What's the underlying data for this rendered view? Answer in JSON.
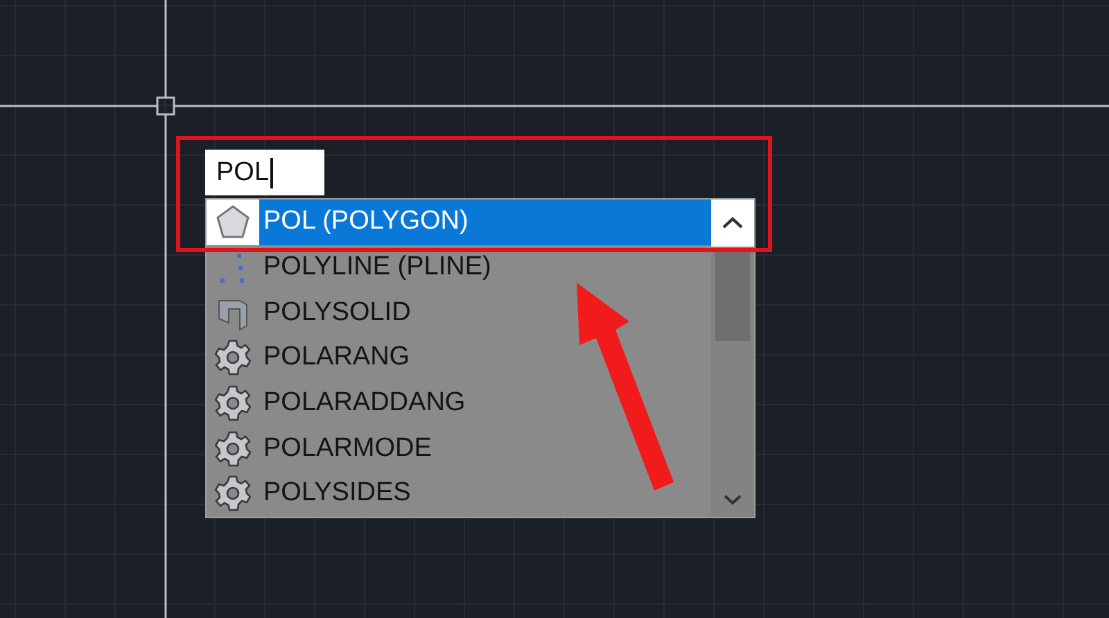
{
  "command_input": {
    "value": "POL"
  },
  "suggestions": [
    {
      "label": "POL (POLYGON)",
      "kind": "polygon",
      "selected": true
    },
    {
      "label": "POLYLINE (PLINE)",
      "kind": "polyline",
      "selected": false
    },
    {
      "label": "POLYSOLID",
      "kind": "polysolid",
      "selected": false
    },
    {
      "label": "POLARANG",
      "kind": "variable",
      "selected": false
    },
    {
      "label": "POLARADDANG",
      "kind": "variable",
      "selected": false
    },
    {
      "label": "POLARMODE",
      "kind": "variable",
      "selected": false
    },
    {
      "label": "POLYSIDES",
      "kind": "variable",
      "selected": false
    }
  ]
}
